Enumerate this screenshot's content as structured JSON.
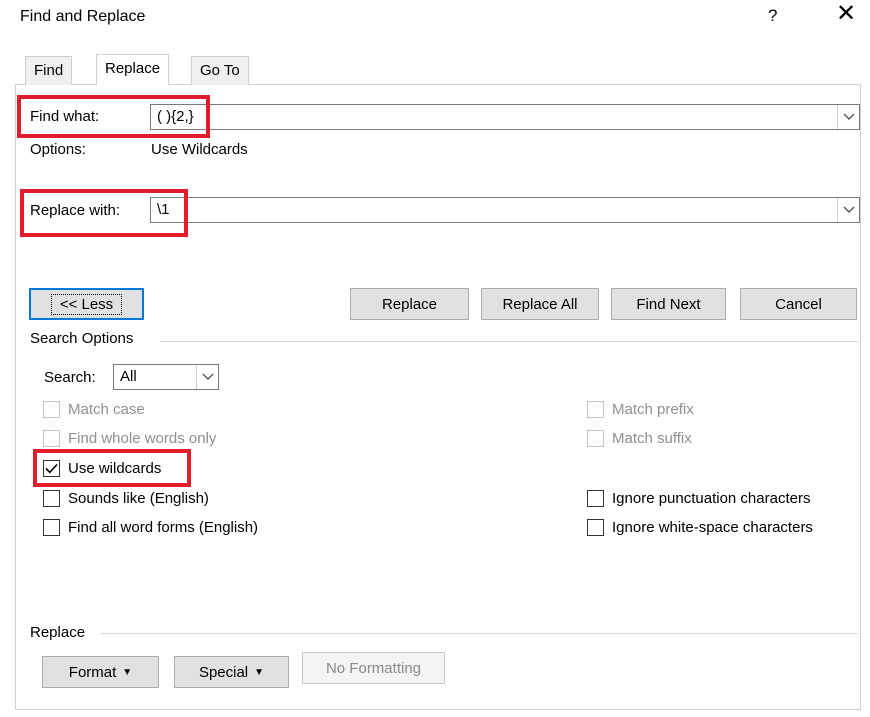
{
  "window": {
    "title": "Find and Replace",
    "help": "?",
    "close": "✕"
  },
  "tabs": [
    {
      "label": "Find",
      "hotkey_index": 2
    },
    {
      "label": "Replace",
      "hotkey_index": 2
    },
    {
      "label": "Go To",
      "hotkey_index": 0
    }
  ],
  "find": {
    "label": "Find what:",
    "value": "( ){2,}"
  },
  "options": {
    "label": "Options:",
    "value": "Use Wildcards"
  },
  "replace": {
    "label": "Replace with:",
    "value": "\\1"
  },
  "buttons": {
    "less": "<< Less",
    "replace": "Replace",
    "replace_all": "Replace All",
    "find_next": "Find Next",
    "cancel": "Cancel"
  },
  "search_options": {
    "title": "Search Options",
    "search_label": "Search:",
    "search_value": "All",
    "left": [
      {
        "label": "Match case",
        "checked": false,
        "enabled": false
      },
      {
        "label": "Find whole words only",
        "checked": false,
        "enabled": false
      },
      {
        "label": "Use wildcards",
        "checked": true,
        "enabled": true
      },
      {
        "label": "Sounds like (English)",
        "checked": false,
        "enabled": true
      },
      {
        "label": "Find all word forms (English)",
        "checked": false,
        "enabled": true
      }
    ],
    "right": [
      {
        "label": "Match prefix",
        "checked": false,
        "enabled": false
      },
      {
        "label": "Match suffix",
        "checked": false,
        "enabled": false
      },
      {
        "label": "Ignore punctuation characters",
        "checked": false,
        "enabled": true
      },
      {
        "label": "Ignore white-space characters",
        "checked": false,
        "enabled": true
      }
    ]
  },
  "replace_section": {
    "title": "Replace",
    "format": "Format",
    "special": "Special",
    "no_formatting": "No Formatting"
  },
  "icons": {
    "dropdown": "chevron-down-icon",
    "check": "checkmark-icon"
  },
  "colors": {
    "highlight": "#e21b2d",
    "focus": "#0078d7"
  }
}
